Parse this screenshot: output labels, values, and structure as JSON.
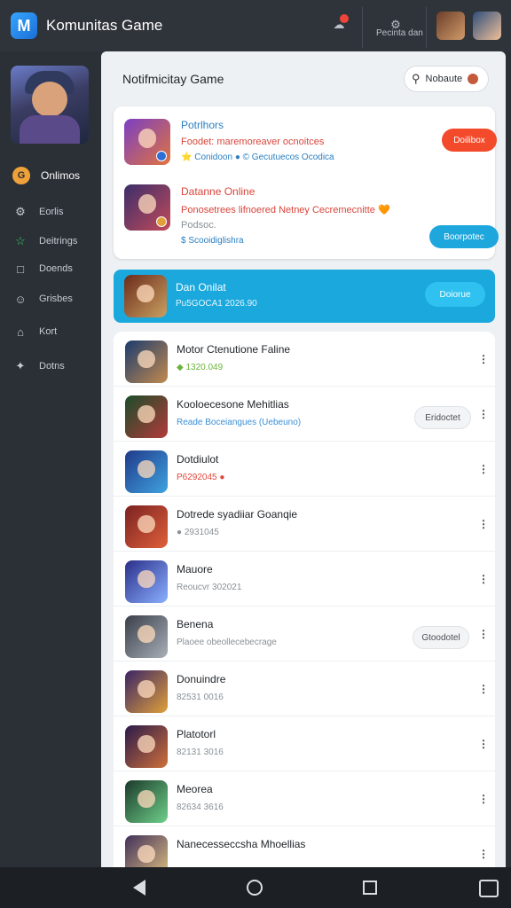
{
  "app": {
    "title": "Komunitas Game",
    "logo_letter": "M",
    "top_label": "Pecinta dan",
    "colors": {
      "accent_blue": "#1ba8dc",
      "accent_red": "#f24a2a",
      "sidebar_bg": "#2b2f36"
    }
  },
  "sidebar": {
    "items": [
      {
        "label": "Onlimos",
        "icon": "game-icon"
      },
      {
        "label": "Eorlis",
        "icon": "gear-icon"
      },
      {
        "label": "Deitrings",
        "icon": "star-icon"
      },
      {
        "label": "Doends",
        "icon": "folder-icon"
      },
      {
        "label": "Grisbes",
        "icon": "people-icon"
      },
      {
        "label": "Kort",
        "icon": "house-icon"
      },
      {
        "label": "Dotns",
        "icon": "pin-icon"
      }
    ]
  },
  "main": {
    "title": "Notifmicitay Game",
    "search": {
      "placeholder": "Nobaute"
    }
  },
  "featured": {
    "first": {
      "title": "Potrlhors",
      "desc": "Foodet: maremoreaver ocnoitces",
      "meta": "⭐ Conidoon  ●  ©  Gecutuecos  Ocodica",
      "button": "Doilibox"
    },
    "second": {
      "title": "Datanne Online",
      "desc": "Ponosetrees lifnoered Netney Cecremecnitte 🧡",
      "desc2": "Podsoc.",
      "meta": "$  Scooidiglishra",
      "button": "Boorpotec"
    }
  },
  "banner": {
    "title": "Dan Onilat",
    "subtitle": "Pu5GOCA1 2026.90",
    "button": "Doiorue"
  },
  "list": [
    {
      "title": "Motor Ctenutione Faline",
      "sub": "◆ 1320.049",
      "sub_color": "#6bb33a",
      "button": null
    },
    {
      "title": "Kooloecesone Mehitlias",
      "sub": "Reade  Boceiangues (Uebeuno)",
      "sub_color": "#3a8fd6",
      "button": "Eridoctet"
    },
    {
      "title": "Dotdiulot",
      "sub": "P6292045 ●",
      "sub_color": "#e0463a",
      "button": null
    },
    {
      "title": "Dotrede syadiiar Goanqie",
      "sub": "● 2931045",
      "sub_color": "#8a9096",
      "button": null
    },
    {
      "title": "Mauore",
      "sub": "Reoucvr 302021",
      "sub_color": "#8a9096",
      "button": null
    },
    {
      "title": "Benena",
      "sub": "Plaoee obeollecebecrage",
      "sub_color": "#8a9096",
      "button": "Gtoodotel"
    },
    {
      "title": "Donuindre",
      "sub": "82531 0016",
      "sub_color": "#8a9096",
      "button": null
    },
    {
      "title": "Platotorl",
      "sub": "82131 3016",
      "sub_color": "#8a9096",
      "button": null
    },
    {
      "title": "Meorea",
      "sub": "82634 3616",
      "sub_color": "#8a9096",
      "button": null
    },
    {
      "title": "Nanecesseccsha Mhoellias",
      "sub": "",
      "sub_color": "#8a9096",
      "button": null
    }
  ]
}
